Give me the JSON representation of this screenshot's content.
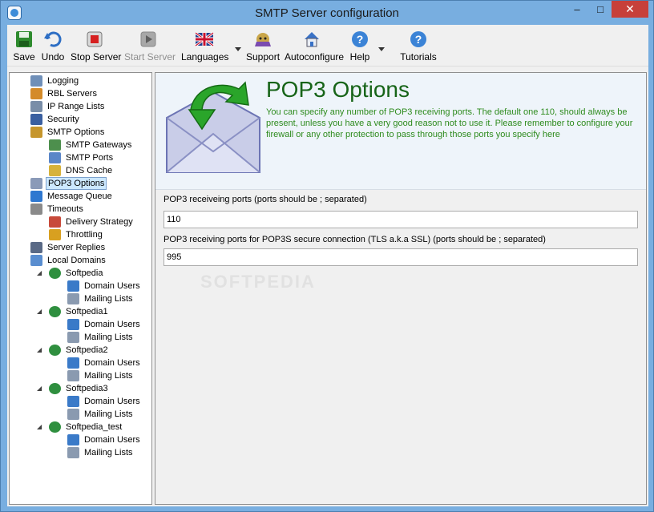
{
  "window": {
    "title": "SMTP Server configuration",
    "minimize": "–",
    "restore": "□",
    "close": "✕"
  },
  "toolbar": [
    {
      "name": "save-button",
      "label": "Save",
      "icon": "save-icon",
      "enabled": true
    },
    {
      "name": "undo-button",
      "label": "Undo",
      "icon": "undo-icon",
      "enabled": true
    },
    {
      "name": "stop-server-button",
      "label": "Stop Server",
      "icon": "stop-icon",
      "enabled": true
    },
    {
      "name": "start-server-button",
      "label": "Start Server",
      "icon": "play-icon",
      "enabled": false
    },
    {
      "name": "languages-button",
      "label": "Languages",
      "icon": "flag-uk-icon",
      "enabled": true
    },
    {
      "name": "support-button",
      "label": "Support",
      "icon": "support-icon",
      "enabled": true
    },
    {
      "name": "autoconfigure-button",
      "label": "Autoconfigure",
      "icon": "house-icon",
      "enabled": true
    },
    {
      "name": "help-button",
      "label": "Help",
      "icon": "help-icon",
      "enabled": true
    },
    {
      "name": "tutorials-button",
      "label": "Tutorials",
      "icon": "help-icon",
      "enabled": true
    }
  ],
  "tree": [
    {
      "label": "Logging",
      "level": 0,
      "icon": "log-icon"
    },
    {
      "label": "RBL Servers",
      "level": 0,
      "icon": "rbl-icon"
    },
    {
      "label": "IP Range Lists",
      "level": 0,
      "icon": "ip-list-icon"
    },
    {
      "label": "Security",
      "level": 0,
      "icon": "security-icon"
    },
    {
      "label": "SMTP Options",
      "level": 0,
      "icon": "smtp-options-icon"
    },
    {
      "label": "SMTP Gateways",
      "level": 1,
      "icon": "gateway-icon"
    },
    {
      "label": "SMTP Ports",
      "level": 1,
      "icon": "ports-icon"
    },
    {
      "label": "DNS Cache",
      "level": 1,
      "icon": "dns-cache-icon"
    },
    {
      "label": "POP3 Options",
      "level": 0,
      "icon": "pop3-icon",
      "selected": true
    },
    {
      "label": "Message Queue",
      "level": 0,
      "icon": "queue-icon"
    },
    {
      "label": "Timeouts",
      "level": 0,
      "icon": "timeouts-icon"
    },
    {
      "label": "Delivery Strategy",
      "level": 1,
      "icon": "calendar-icon"
    },
    {
      "label": "Throttling",
      "level": 1,
      "icon": "traffic-light-icon"
    },
    {
      "label": "Server Replies",
      "level": 0,
      "icon": "server-icon"
    },
    {
      "label": "Local Domains",
      "level": 0,
      "icon": "domains-icon"
    },
    {
      "label": "Softpedia",
      "level": 1,
      "icon": "globe-icon",
      "expander": true
    },
    {
      "label": "Domain Users",
      "level": 2,
      "icon": "users-icon"
    },
    {
      "label": "Mailing Lists",
      "level": 2,
      "icon": "list-icon"
    },
    {
      "label": "Softpedia1",
      "level": 1,
      "icon": "globe-icon",
      "expander": true
    },
    {
      "label": "Domain Users",
      "level": 2,
      "icon": "users-icon"
    },
    {
      "label": "Mailing Lists",
      "level": 2,
      "icon": "list-icon"
    },
    {
      "label": "Softpedia2",
      "level": 1,
      "icon": "globe-icon",
      "expander": true
    },
    {
      "label": "Domain Users",
      "level": 2,
      "icon": "users-icon"
    },
    {
      "label": "Mailing Lists",
      "level": 2,
      "icon": "list-icon"
    },
    {
      "label": "Softpedia3",
      "level": 1,
      "icon": "globe-icon",
      "expander": true
    },
    {
      "label": "Domain Users",
      "level": 2,
      "icon": "users-icon"
    },
    {
      "label": "Mailing Lists",
      "level": 2,
      "icon": "list-icon"
    },
    {
      "label": "Softpedia_test",
      "level": 1,
      "icon": "globe-icon",
      "expander": true
    },
    {
      "label": "Domain Users",
      "level": 2,
      "icon": "users-icon"
    },
    {
      "label": "Mailing Lists",
      "level": 2,
      "icon": "list-icon"
    }
  ],
  "tree_expander": "◢",
  "panel": {
    "title": "POP3 Options",
    "description": "You can specify any number of POP3 receiving ports. The default one 110, should always be present, unless you have a very good reason not to use it. Please remember to configure your firewall or any other protection to pass through those ports you specify here",
    "pop3_label": "POP3 receiveing ports (ports should be ; separated)",
    "pop3_value": "110",
    "pop3s_label": "POP3 receiving ports for POP3S secure connection (TLS a.k.a SSL)  (ports should be ; separated)",
    "pop3s_value": "995"
  },
  "watermark": "SOFTPEDIA"
}
